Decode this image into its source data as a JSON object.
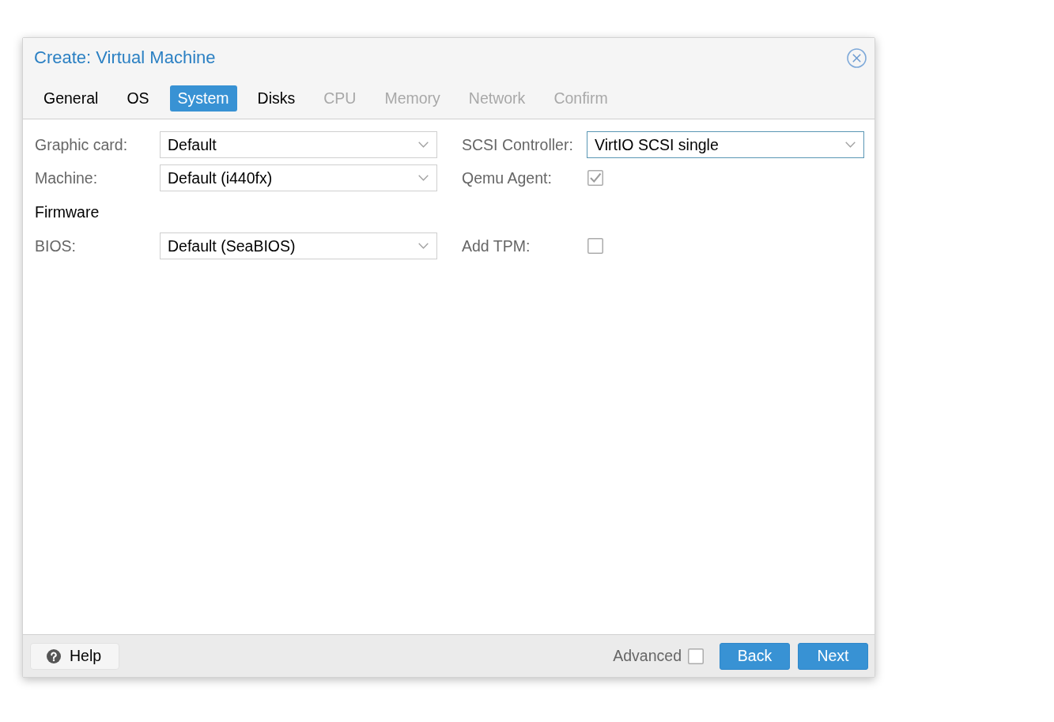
{
  "window": {
    "title": "Create: Virtual Machine"
  },
  "tabs": [
    {
      "label": "General",
      "selected": false,
      "disabled": false
    },
    {
      "label": "OS",
      "selected": false,
      "disabled": false
    },
    {
      "label": "System",
      "selected": true,
      "disabled": false
    },
    {
      "label": "Disks",
      "selected": false,
      "disabled": false
    },
    {
      "label": "CPU",
      "selected": false,
      "disabled": true
    },
    {
      "label": "Memory",
      "selected": false,
      "disabled": true
    },
    {
      "label": "Network",
      "selected": false,
      "disabled": true
    },
    {
      "label": "Confirm",
      "selected": false,
      "disabled": true
    }
  ],
  "form": {
    "rows": [
      {
        "left": {
          "kind": "select",
          "label": "Graphic card:",
          "value": "Default",
          "focused": false
        },
        "right": {
          "kind": "select",
          "label": "SCSI Controller:",
          "value": "VirtIO SCSI single",
          "focused": true
        }
      },
      {
        "left": {
          "kind": "select",
          "label": "Machine:",
          "value": "Default (i440fx)",
          "focused": false
        },
        "right": {
          "kind": "checkbox",
          "label": "Qemu Agent:",
          "checked": true
        }
      },
      {
        "left": {
          "kind": "heading",
          "label": "Firmware"
        }
      },
      {
        "left": {
          "kind": "select",
          "label": "BIOS:",
          "value": "Default (SeaBIOS)",
          "focused": false
        },
        "right": {
          "kind": "checkbox",
          "label": "Add TPM:",
          "checked": false
        }
      }
    ]
  },
  "footer": {
    "help": {
      "label": "Help"
    },
    "advanced": {
      "label": "Advanced",
      "checked": false
    },
    "buttons": [
      {
        "label": "Back"
      },
      {
        "label": "Next"
      }
    ]
  }
}
